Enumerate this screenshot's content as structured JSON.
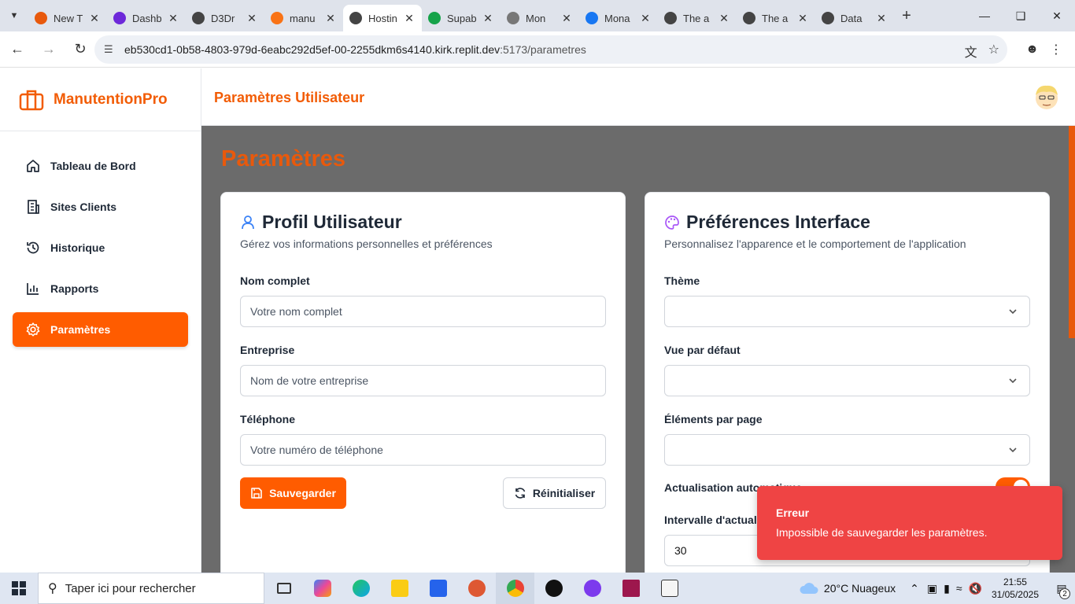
{
  "browser": {
    "tabs": [
      {
        "label": "New T",
        "color": "#e8590c",
        "active": false
      },
      {
        "label": "Dashb",
        "color": "#6d28d9",
        "active": false
      },
      {
        "label": "D3Dr",
        "color": "#444444",
        "active": false
      },
      {
        "label": "manu",
        "color": "#f97316",
        "active": false
      },
      {
        "label": "Hostin",
        "color": "#444444",
        "active": true
      },
      {
        "label": "Supab",
        "color": "#16a34a",
        "active": false
      },
      {
        "label": "Mon",
        "color": "#777777",
        "active": false
      },
      {
        "label": "Mona",
        "color": "#1877f2",
        "active": false
      },
      {
        "label": "The a",
        "color": "#444444",
        "active": false
      },
      {
        "label": "The a",
        "color": "#444444",
        "active": false
      },
      {
        "label": "Data",
        "color": "#444444",
        "active": false
      }
    ],
    "url_host": "eb530cd1-0b58-4803-979d-6eabc292d5ef-00-2255dkm6s4140.kirk.replit.dev",
    "url_path": ":5173/parametres"
  },
  "sidebar": {
    "brand": "ManutentionPro",
    "items": [
      {
        "label": "Tableau de Bord",
        "icon": "home-icon"
      },
      {
        "label": "Sites Clients",
        "icon": "building-icon"
      },
      {
        "label": "Historique",
        "icon": "history-icon"
      },
      {
        "label": "Rapports",
        "icon": "chart-icon"
      },
      {
        "label": "Paramètres",
        "icon": "gear-icon"
      }
    ]
  },
  "header": {
    "title": "Paramètres Utilisateur"
  },
  "page": {
    "title": "Paramètres"
  },
  "profile": {
    "title": "Profil Utilisateur",
    "subtitle": "Gérez vos informations personnelles et préférences",
    "fields": [
      {
        "label": "Nom complet",
        "placeholder": "Votre nom complet"
      },
      {
        "label": "Entreprise",
        "placeholder": "Nom de votre entreprise"
      },
      {
        "label": "Téléphone",
        "placeholder": "Votre numéro de téléphone"
      }
    ],
    "save_label": "Sauvegarder",
    "reset_label": "Réinitialiser"
  },
  "preferences": {
    "title": "Préférences Interface",
    "subtitle": "Personnalisez l'apparence et le comportement de l'application",
    "theme_label": "Thème",
    "view_label": "Vue par défaut",
    "items_label": "Éléments par page",
    "auto_refresh_label": "Actualisation automatique",
    "auto_refresh_on": true,
    "interval_label": "Intervalle d'actualisation",
    "interval_value": "30"
  },
  "toast": {
    "title": "Erreur",
    "message": "Impossible de sauvegarder les paramètres."
  },
  "taskbar": {
    "search_placeholder": "Taper ici pour rechercher",
    "weather": "20°C  Nuageux",
    "time": "21:55",
    "date": "31/05/2025",
    "notifications": "2"
  },
  "colors": {
    "accent": "#ff5c00",
    "error": "#ef4444"
  }
}
